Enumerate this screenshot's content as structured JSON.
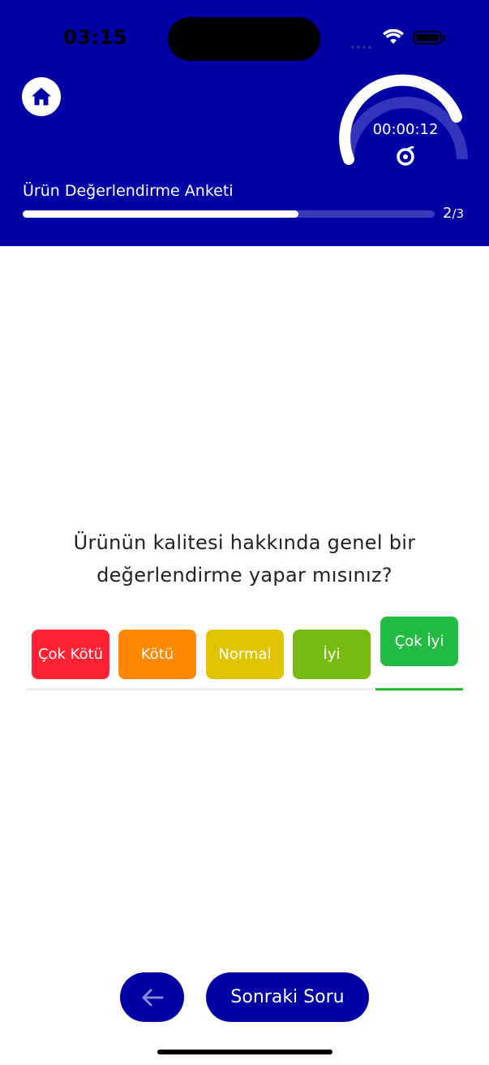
{
  "status_bar": {
    "time": "03:15"
  },
  "header": {
    "timer": "00:00:12",
    "survey_title": "Ürün Değerlendirme Anketi",
    "progress": {
      "current": "2",
      "separator": "/",
      "total": "3",
      "fraction": 0.67
    }
  },
  "question": {
    "text": "Ürünün kalitesi hakkında genel bir değerlendirme yapar mısınız?",
    "options": [
      {
        "label": "Çok Kötü",
        "color": "#ff2233",
        "selected": false
      },
      {
        "label": "Kötü",
        "color": "#ff8800",
        "selected": false
      },
      {
        "label": "Normal",
        "color": "#e0c400",
        "selected": false
      },
      {
        "label": "İyi",
        "color": "#77bb11",
        "selected": false
      },
      {
        "label": "Çok İyi",
        "color": "#22bb44",
        "selected": true
      }
    ]
  },
  "footer": {
    "back_icon": "arrow-left-icon",
    "next_label": "Sonraki Soru"
  },
  "colors": {
    "primary": "#0000a5",
    "accent_selected": "#22bb33"
  },
  "icons": [
    "home-icon",
    "timer-icon",
    "wifi-icon",
    "battery-icon",
    "arrow-left-icon"
  ]
}
